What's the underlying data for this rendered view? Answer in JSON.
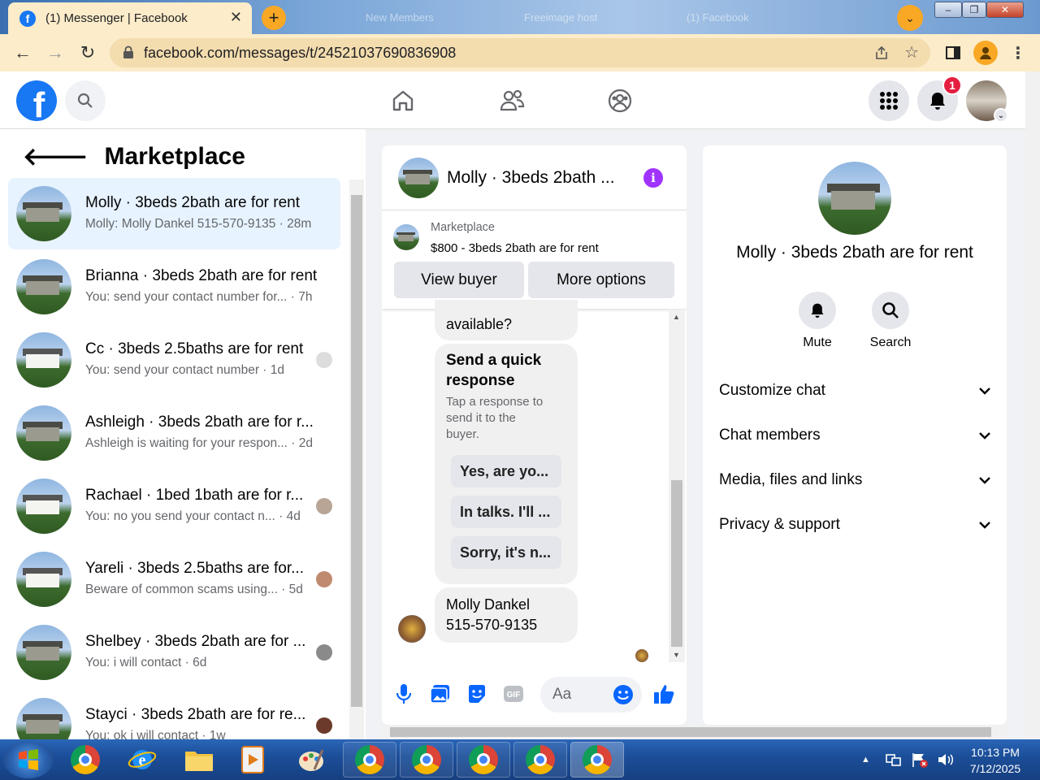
{
  "browser": {
    "tab_title": "(1) Messenger | Facebook",
    "bg_tabs": [
      "New Members",
      "Freeimage host",
      "(1) Facebook"
    ],
    "url": "facebook.com/messages/t/24521037690836908"
  },
  "header": {
    "notification_count": "1"
  },
  "left": {
    "title": "Marketplace",
    "conversations": [
      {
        "name": "Molly · 3beds 2bath are for rent",
        "snippet": "Molly: Molly Dankel 515-570-9135 · 28m"
      },
      {
        "name": "Brianna · 3beds 2bath are for rent",
        "snippet": "You: send your contact number for... · 7h"
      },
      {
        "name": "Cc · 3beds 2.5baths are for rent",
        "snippet": "You: send your contact number · 1d"
      },
      {
        "name": "Ashleigh · 3beds 2bath are for r...",
        "snippet": "Ashleigh is waiting for your respon... · 2d"
      },
      {
        "name": "Rachael · 1bed 1bath are for r...",
        "snippet": "You: no you send your contact n... · 4d"
      },
      {
        "name": "Yareli · 3beds 2.5baths are for...",
        "snippet": "Beware of common scams using... · 5d"
      },
      {
        "name": "Shelbey · 3beds 2bath are for ...",
        "snippet": "You: i will contact · 6d"
      },
      {
        "name": "Stayci · 3beds 2bath are for re...",
        "snippet": "You: ok i will contact · 1w"
      }
    ]
  },
  "chat": {
    "title": "Molly · 3beds 2bath ...",
    "marketplace_label": "Marketplace",
    "listing": "$800 - 3beds 2bath are for rent",
    "view_buyer": "View buyer",
    "more_options": "More options",
    "prev_bubble": "available?",
    "quick_title_1": "Send a quick",
    "quick_title_2": "response",
    "quick_hint_1": "Tap a response to",
    "quick_hint_2": "send it to the",
    "quick_hint_3": "buyer.",
    "chips": [
      "Yes, are yo...",
      "In talks. I'll ...",
      "Sorry, it's n..."
    ],
    "last_msg_1": "Molly Dankel",
    "last_msg_2": "515-570-9135",
    "composer_placeholder": "Aa"
  },
  "right": {
    "title": "Molly · 3beds 2bath are for rent",
    "mute": "Mute",
    "search": "Search",
    "sections": [
      "Customize chat",
      "Chat members",
      "Media, files and links",
      "Privacy & support"
    ]
  },
  "taskbar": {
    "time": "10:13 PM",
    "date": "7/12/2025"
  }
}
